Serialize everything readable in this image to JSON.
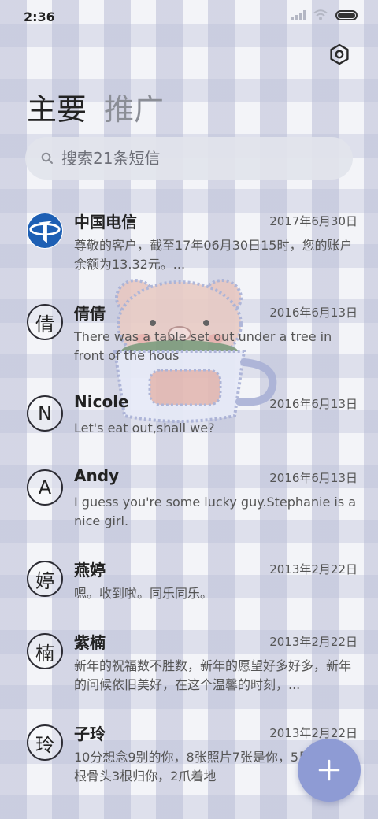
{
  "status_bar": {
    "time": "2:36",
    "battery_level": 1.0
  },
  "tabs": [
    {
      "label": "主要",
      "active": true
    },
    {
      "label": "推广",
      "active": false
    }
  ],
  "search": {
    "placeholder": "搜索21条短信"
  },
  "messages": [
    {
      "avatar": "",
      "avatar_type": "china-telecom-logo",
      "name": "中国电信",
      "date": "2017年6月30日",
      "preview": "尊敬的客户，截至17年06月30日15时，您的账户余额为13.32元。..."
    },
    {
      "avatar": "倩",
      "name": "倩倩",
      "date": "2016年6月13日",
      "preview": "There was a table set out under a tree in front of the hous"
    },
    {
      "avatar": "N",
      "name": "Nicole",
      "date": "2016年6月13日",
      "preview": "Let's eat out,shall we?"
    },
    {
      "avatar": "A",
      "name": "Andy",
      "date": "2016年6月13日",
      "preview": "I guess you're some lucky guy.Stephanie is a nice girl."
    },
    {
      "avatar": "婷",
      "name": "燕婷",
      "date": "2013年2月22日",
      "preview": "嗯。收到啦。同乐同乐。"
    },
    {
      "avatar": "楠",
      "name": "紫楠",
      "date": "2013年2月22日",
      "preview": "新年的祝福数不胜数，新年的愿望好多好多，新年的问候依旧美好，在这个温馨的时刻，..."
    },
    {
      "avatar": "玲",
      "name": "子玲",
      "date": "2013年2月22日",
      "preview": "10分想念9别的你，8张照片7张是你，5只像你，4根骨头3根归你，2爪着地"
    }
  ],
  "colors": {
    "fab": "#8e9bd4",
    "telecom_blue": "#1d5fb4",
    "text": "#222222"
  }
}
